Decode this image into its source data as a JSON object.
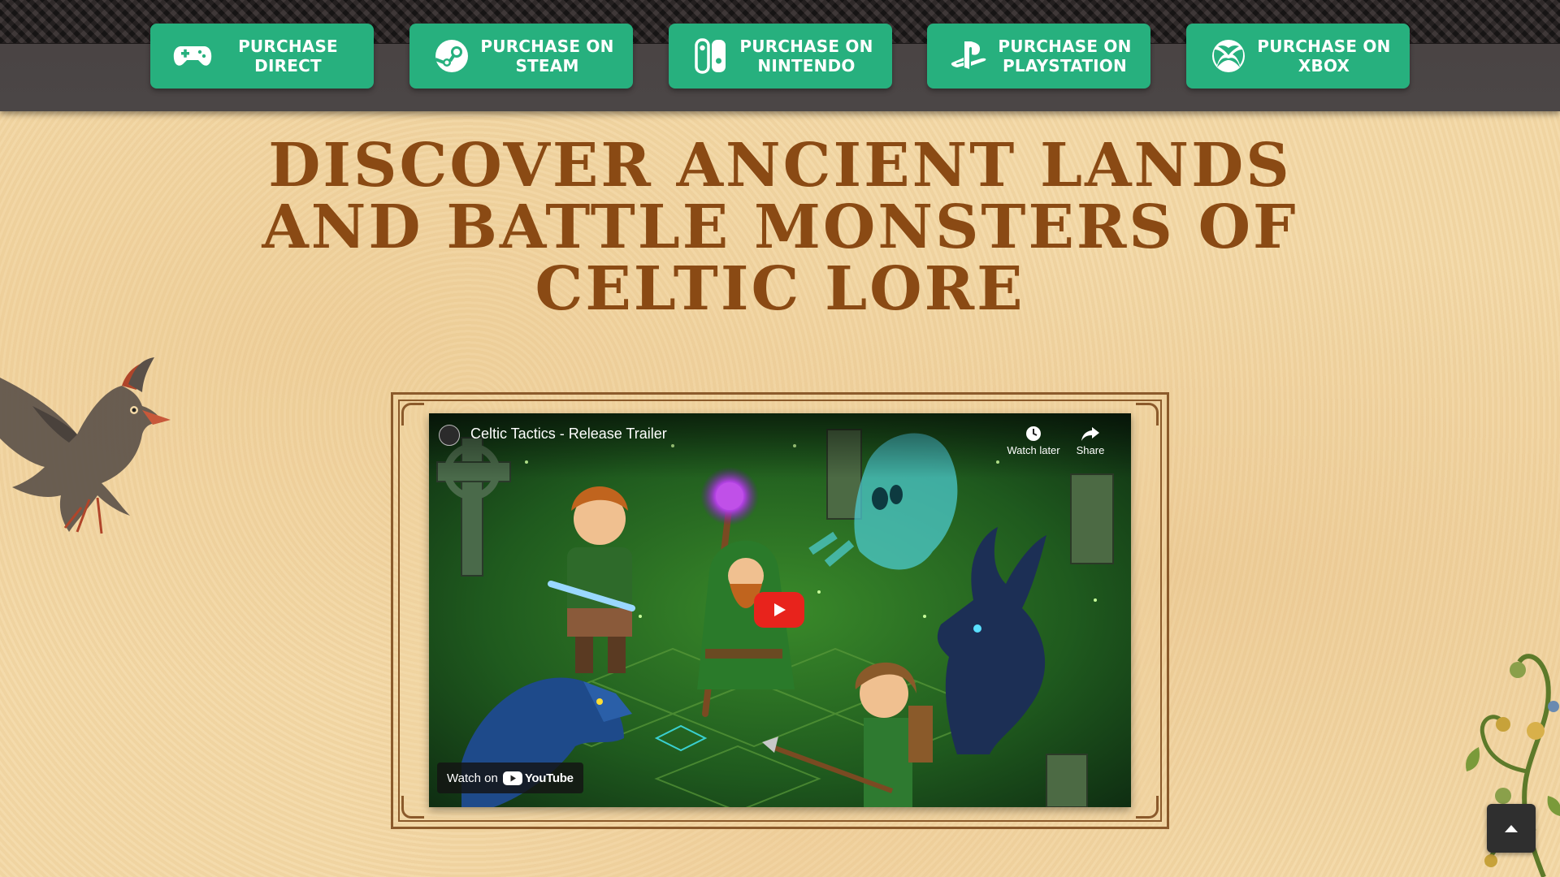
{
  "nav": {
    "buttons": [
      {
        "label": "PURCHASE DIRECT",
        "icon": "gamepad-icon"
      },
      {
        "label": "PURCHASE ON STEAM",
        "icon": "steam-icon"
      },
      {
        "label": "PURCHASE ON NINTENDO",
        "icon": "nintendo-switch-icon"
      },
      {
        "label": "PURCHASE ON PLAYSTATION",
        "icon": "playstation-icon"
      },
      {
        "label": "PURCHASE ON XBOX",
        "icon": "xbox-icon"
      }
    ],
    "button_color": "#27b07e",
    "bar_color": "#4a4444"
  },
  "headline": "DISCOVER ANCIENT LANDS AND BATTLE MONSTERS OF CELTIC LORE",
  "video": {
    "title": "Celtic Tactics - Release Trailer",
    "watch_later": "Watch later",
    "share": "Share",
    "watch_on": "Watch on",
    "brand": "YouTube"
  },
  "colors": {
    "parchment": "#f3d8a6",
    "heading": "#8a4a14",
    "frame": "#8b5a2b",
    "play_red": "#e8231c"
  }
}
